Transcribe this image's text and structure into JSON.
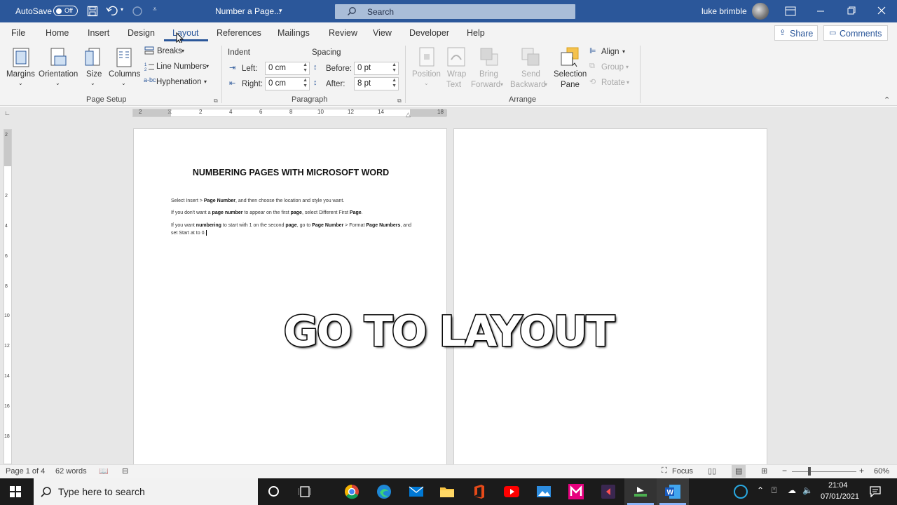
{
  "window": {
    "autosave_label": "AutoSave",
    "autosave_state": "Off",
    "doc_title": "Number a Page...",
    "search_placeholder": "Search",
    "user_name": "luke brimble"
  },
  "tabs": [
    "File",
    "Home",
    "Insert",
    "Design",
    "Layout",
    "References",
    "Mailings",
    "Review",
    "View",
    "Developer",
    "Help"
  ],
  "active_tab": "Layout",
  "share_label": "Share",
  "comments_label": "Comments",
  "ribbon": {
    "page_setup": {
      "margins": "Margins",
      "orientation": "Orientation",
      "size": "Size",
      "columns": "Columns",
      "breaks": "Breaks",
      "line_numbers": "Line Numbers",
      "hyphenation": "Hyphenation",
      "group_label": "Page Setup"
    },
    "paragraph": {
      "indent_label": "Indent",
      "spacing_label": "Spacing",
      "left_label": "Left:",
      "left_value": "0 cm",
      "right_label": "Right:",
      "right_value": "0 cm",
      "before_label": "Before:",
      "before_value": "0 pt",
      "after_label": "After:",
      "after_value": "8 pt",
      "group_label": "Paragraph"
    },
    "arrange": {
      "position": "Position",
      "wrap_text_1": "Wrap",
      "wrap_text_2": "Text",
      "bring_forward_1": "Bring",
      "bring_forward_2": "Forward",
      "send_backward_1": "Send",
      "send_backward_2": "Backward",
      "selection_pane_1": "Selection",
      "selection_pane_2": "Pane",
      "align": "Align",
      "group": "Group",
      "rotate": "Rotate",
      "group_label": "Arrange"
    }
  },
  "ruler": {
    "ticks": [
      "2",
      "2",
      "4",
      "6",
      "8",
      "10",
      "12",
      "14",
      "18"
    ],
    "vticks": [
      "2",
      "2",
      "4",
      "6",
      "8",
      "10",
      "12",
      "14",
      "16",
      "18"
    ]
  },
  "document": {
    "heading": "NUMBERING PAGES WITH MICROSOFT WORD",
    "p1": [
      {
        "t": "Select Insert > ",
        "b": false
      },
      {
        "t": "Page Number",
        "b": true
      },
      {
        "t": ", and then choose the location and style you want.",
        "b": false
      }
    ],
    "p2": [
      {
        "t": "If you don't want a ",
        "b": false
      },
      {
        "t": "page number",
        "b": true
      },
      {
        "t": " to appear on the first ",
        "b": false
      },
      {
        "t": "page",
        "b": true
      },
      {
        "t": ", select Different First ",
        "b": false
      },
      {
        "t": "Page",
        "b": true
      },
      {
        "t": ".",
        "b": false
      }
    ],
    "p3": [
      {
        "t": "If you want ",
        "b": false
      },
      {
        "t": "numbering",
        "b": true
      },
      {
        "t": " to start with 1 on the second ",
        "b": false
      },
      {
        "t": "page",
        "b": true
      },
      {
        "t": ", go to ",
        "b": false
      },
      {
        "t": "Page Number",
        "b": true
      },
      {
        "t": " > Format ",
        "b": false
      },
      {
        "t": "Page Numbers",
        "b": true
      },
      {
        "t": ", and set Start at to 0.",
        "b": false
      }
    ]
  },
  "overlay_text": "GO TO LAYOUT",
  "status": {
    "page": "Page 1 of 4",
    "words": "62 words",
    "focus": "Focus",
    "zoom": "60%"
  },
  "taskbar": {
    "search_placeholder": "Type here to search",
    "time": "21:04",
    "date": "07/01/2021"
  },
  "colors": {
    "word_blue": "#2b579a",
    "taskbar": "#1b1b1b",
    "accent_tab": "#2b579a"
  }
}
